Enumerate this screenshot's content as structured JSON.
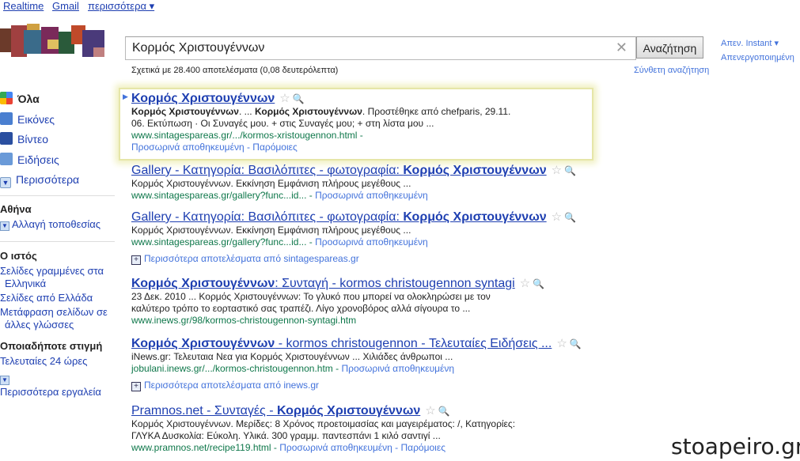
{
  "topbar": {
    "realtime": "Realtime",
    "gmail": "Gmail",
    "more": "περισσότερα ▾"
  },
  "search": {
    "query": "Κορμός Χριστουγέννων",
    "button": "Αναζήτηση"
  },
  "instant": {
    "line1": "Απεν. Instant ▾",
    "line2": "Απενεργοποιημένη"
  },
  "stats": "Σχετικά με 28.400 αποτελέσματα (0,08 δευτερόλεπτα)",
  "advanced": "Σύνθετη αναζήτηση",
  "sidebar": {
    "types": [
      "Όλα",
      "Εικόνες",
      "Βίντεο",
      "Ειδήσεις",
      "Περισσότερα"
    ],
    "location_head": "Αθήνα",
    "location_change": "Αλλαγή τοποθεσίας",
    "web_head": "Ο ιστός",
    "web_links": [
      "Σελίδες γραμμένες στα",
      "Ελληνικά",
      "Σελίδες από Ελλάδα",
      "Μετάφραση σελίδων σε",
      "άλλες γλώσσες"
    ],
    "time_head": "Οποιαδήποτε στιγμή",
    "time_link": "Τελευταίες 24 ώρες",
    "tools": "Περισσότερα εργαλεία"
  },
  "results": [
    {
      "title_pre": "",
      "title_bold": "Κορμός Χριστουγέννων",
      "title_post": "",
      "snippet_html_parts": [
        "Κορμός Χριστουγέννων",
        ". ... ",
        "Κορμός Χριστουγέννων",
        ". Προστέθηκε από chefparis, 29.11.",
        "06. Εκτύπωση · Οι Συναγές μου. + στις Συναγές μου; + στη λίστα μου ..."
      ],
      "snip1": "Κορμός Χριστουγέννων. ... Κορμός Χριστουγέννων. Προστέθηκε από chefparis, 29.11.",
      "snip2": "06. Εκτύπωση · Οι Συναγές μου. + στις Συναγές μου; + στη λίστα μου ...",
      "url": "www.sintagespareas.gr/.../kormos-xristougennon.html -",
      "cache": "Προσωρινά αποθηκευμένη - Παρόμοιες"
    },
    {
      "title_pre": "Gallery - Κατηγορία: Βασιλόπιτες - φωτογραφία: ",
      "title_bold": "Κορμός Χριστουγέννων",
      "title_post": "",
      "snip1": "Κορμός Χριστουγέννων. Εκκίνηση Εμφάνιση πλήρους μεγέθους ...",
      "url": "www.sintagespareas.gr/gallery?func...id... - ",
      "cache": "Προσωρινά αποθηκευμένη"
    },
    {
      "title_pre": "Gallery - Κατηγορία: Βασιλόπιτες - φωτογραφία: ",
      "title_bold": "Κορμός Χριστουγέννων",
      "title_post": "",
      "snip1": "Κορμός Χριστουγέννων. Εκκίνηση Εμφάνιση πλήρους μεγέθους ...",
      "url": "www.sintagespareas.gr/gallery?func...id... - ",
      "cache": "Προσωρινά αποθηκευμένη"
    },
    {
      "title_pre": "",
      "title_bold": "Κορμός Χριστουγέννων",
      "title_post": ": Συνταγή - kormos christougennon syntagi",
      "snip1": "23 Δεκ. 2010 ... Κορμός Χριστουγέννων: Το γλυκό που μπορεί να ολοκληρώσει με τον",
      "snip2": "καλύτερο τρόπο το εορταστικό σας τραπέζι. Λίγο χρονοβόρος αλλά σίγουρα το ...",
      "url": "www.inews.gr/98/kormos-christougennon-syntagi.htm",
      "cache": ""
    },
    {
      "title_pre": "",
      "title_bold": "Κορμός Χριστουγέννων",
      "title_post": " - kormos christougennon - Τελευταίες Ειδήσεις ...",
      "snip1": "iNews.gr: Τελευταια Νεα για Κορμός Χριστουγέννων ... Χιλιάδες άνθρωποι ...",
      "url": "jobulani.inews.gr/.../kormos-christougennon.htm - ",
      "cache": "Προσωρινά αποθηκευμένη"
    },
    {
      "title_pre": "Pramnos.net - Συνταγές - ",
      "title_bold": "Κορμός Χριστουγέννων",
      "title_post": "",
      "snip1": "Κορμός Χριστουγέννων. Μερίδες: 8 Χρόνος προετοιμασίας και μαγειρέματος: /, Κατηγορίες:",
      "snip2": "ΓΛΥΚΑ Δυσκολία: Εύκολη. Υλικά. 300 γραμμ. παντεσπάνι 1 κιλό σαντιγί ...",
      "url": "www.pramnos.net/recipe119.html - ",
      "cache": "Προσωρινά αποθηκευμένη - Παρόμοιες"
    }
  ],
  "more_results": [
    "Περισσότερα αποτελέσματα από sintagespareas.gr",
    "Περισσότερα αποτελέσματα από inews.gr"
  ],
  "watermark": "stoapeiro.gr"
}
